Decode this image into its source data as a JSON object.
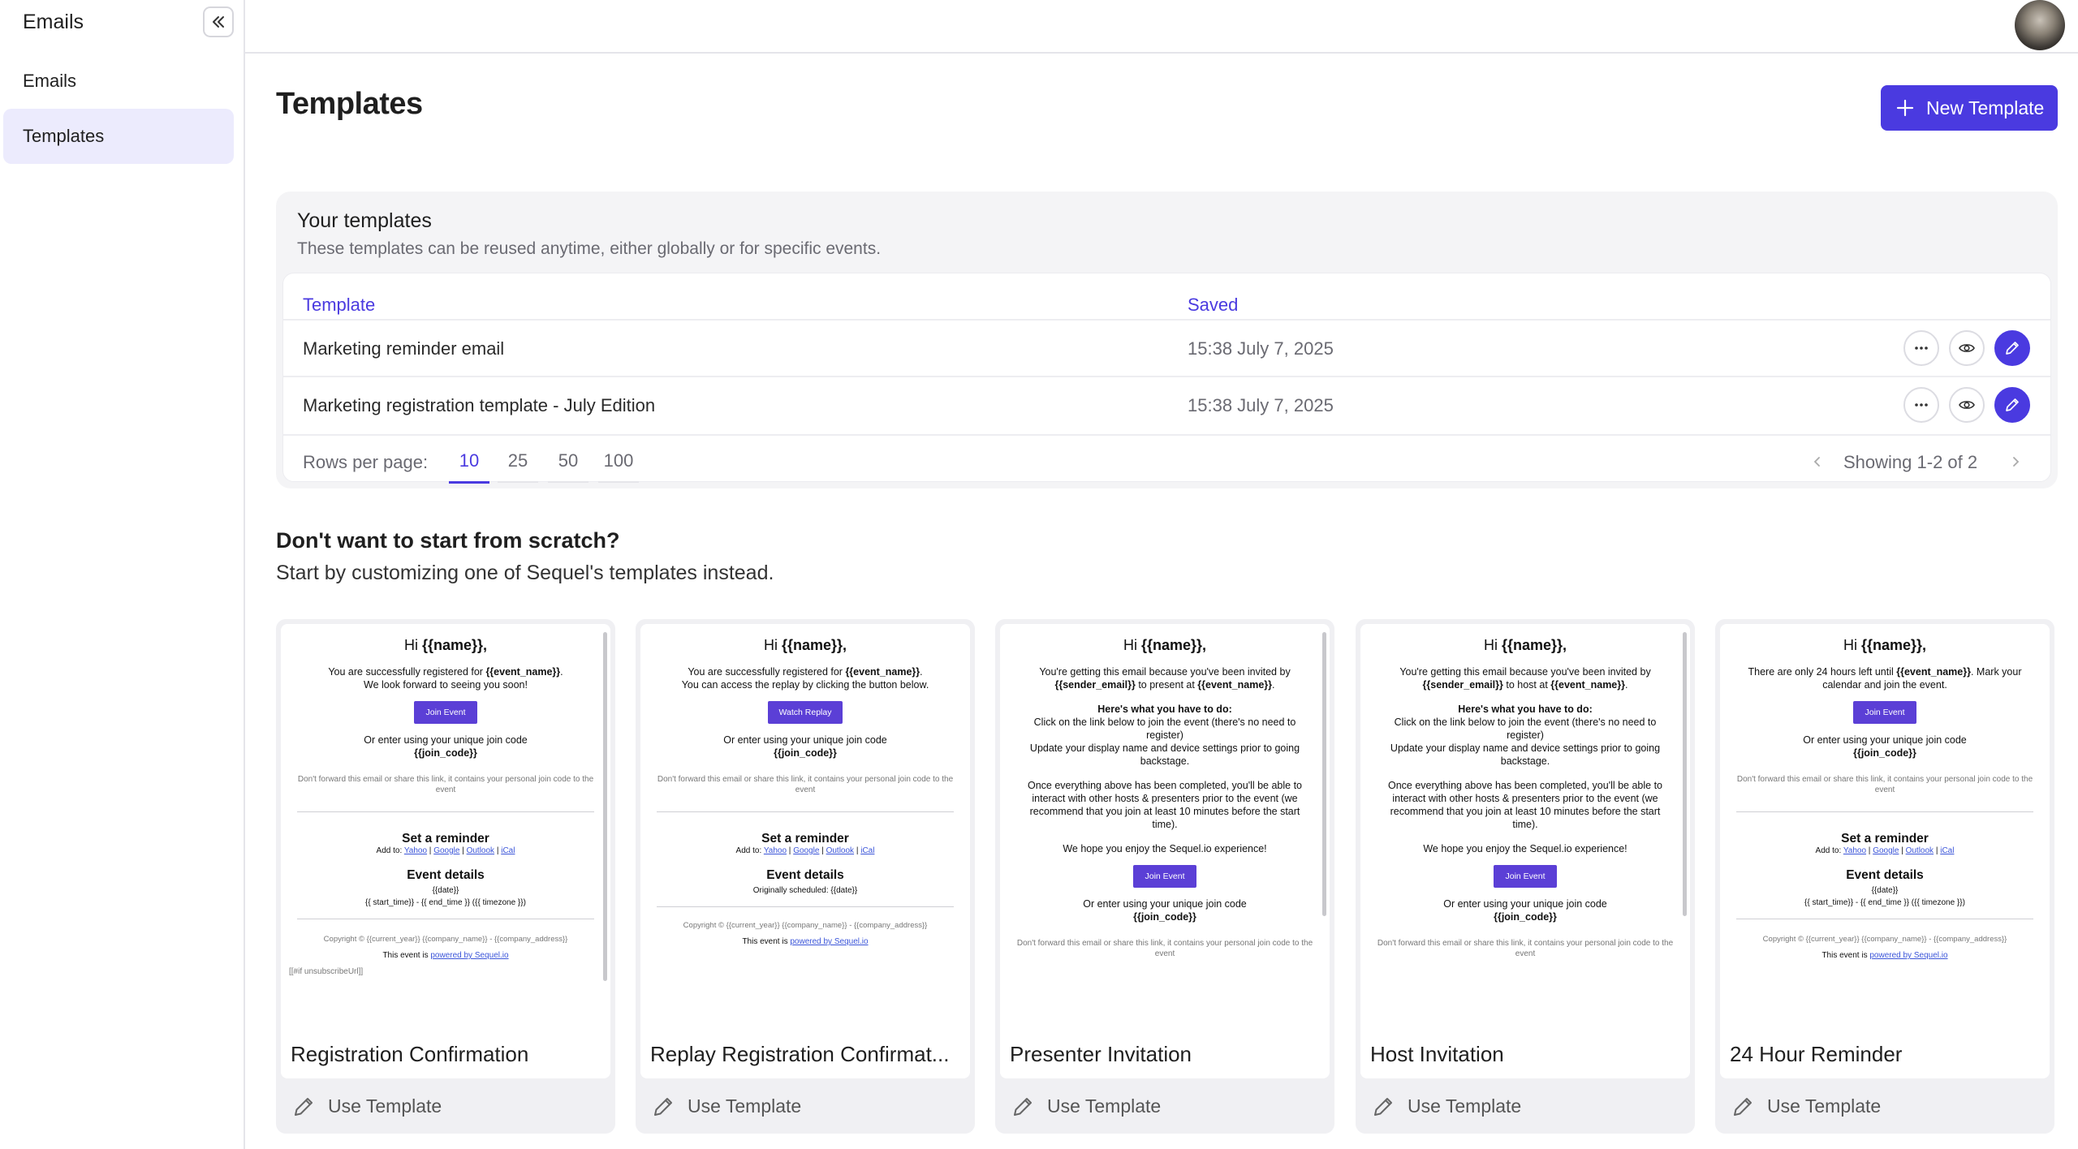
{
  "sidebar": {
    "title": "Emails",
    "items": [
      {
        "label": "Emails",
        "active": false
      },
      {
        "label": "Templates",
        "active": true
      }
    ]
  },
  "page": {
    "title": "Templates",
    "new_button_label": "New Template"
  },
  "your_templates": {
    "title": "Your templates",
    "subtitle": "These templates can be reused anytime, either globally or for specific events.",
    "columns": [
      "Template",
      "Saved"
    ],
    "rows": [
      {
        "name": "Marketing reminder email",
        "saved": "15:38 July 7, 2025"
      },
      {
        "name": "Marketing registration template - July Edition",
        "saved": "15:38 July 7, 2025"
      }
    ],
    "rows_per_page_label": "Rows per page:",
    "rows_per_page_options": [
      "10",
      "25",
      "50",
      "100"
    ],
    "rows_per_page_selected": "10",
    "showing": "Showing 1-2 of 2"
  },
  "scratch": {
    "title": "Don't want to start from scratch?",
    "subtitle": "Start by customizing one of Sequel's templates instead."
  },
  "cards": [
    {
      "name": "Registration Confirmation",
      "action": "Use Template",
      "preview": {
        "greet_prefix": "Hi ",
        "greet_var": "{{name}},",
        "l1a": "You are successfully registered for ",
        "l1b": "{{event_name}}",
        "l1c": ".",
        "l2": "We look forward to seeing you soon!",
        "button": "Join Event",
        "code_line": "Or enter using your unique join code",
        "code": "{{join_code}}",
        "note": "Don't forward this email or share this link, it contains your personal join code to the event",
        "reminder_title": "Set a reminder",
        "add_to": "Add to:",
        "cal": [
          "Yahoo",
          "Google",
          "Outlook",
          "iCal"
        ],
        "details_title": "Event details",
        "date": "{{date}}",
        "time": "{{ start_time}} - {{ end_time }} ({{ timezone }})",
        "copyright": "Copyright © {{current_year}} {{company_name}} - {{company_address}}",
        "powered_prefix": "This event is ",
        "powered": "powered by Sequel.io",
        "unsub": "[[#if unsubscribeUrl]]"
      }
    },
    {
      "name": "Replay Registration Confirmat...",
      "action": "Use Template",
      "preview": {
        "greet_prefix": "Hi ",
        "greet_var": "{{name}},",
        "l1a": "You are successfully registered for ",
        "l1b": "{{event_name}}",
        "l1c": ".",
        "l2": "You can access the replay by clicking the button below.",
        "button": "Watch Replay",
        "code_line": "Or enter using your unique join code",
        "code": "{{join_code}}",
        "note": "Don't forward this email or share this link, it contains your personal join code to the event",
        "reminder_title": "Set a reminder",
        "add_to": "Add to:",
        "cal": [
          "Yahoo",
          "Google",
          "Outlook",
          "iCal"
        ],
        "details_title": "Event details",
        "orig": "Originally scheduled: {{date}}",
        "copyright": "Copyright © {{current_year}} {{company_name}} - {{company_address}}",
        "powered_prefix": "This event is ",
        "powered": "powered by Sequel.io"
      }
    },
    {
      "name": "Presenter Invitation",
      "action": "Use Template",
      "preview": {
        "greet_prefix": "Hi ",
        "greet_var": "{{name}},",
        "l1a": "You're getting this email because you've been invited by ",
        "l1b": "{{sender_email}}",
        "l1c": " to present at ",
        "l1d": "{{event_name}}",
        "l1e": ".",
        "todo_title": "Here's what you have to do:",
        "todo1": "Click on the link below to join the event (there's no need to register)",
        "todo2": "Update your display name and device settings prior to going backstage.",
        "after": "Once everything above has been completed, you'll be able to interact with other hosts & presenters prior to the event (we recommend that you join at least 10 minutes before the start time).",
        "enjoy": "We hope you enjoy the Sequel.io experience!",
        "button": "Join Event",
        "code_line": "Or enter using your unique join code",
        "code": "{{join_code}}",
        "note": "Don't forward this email or share this link, it contains your personal join code to the event"
      }
    },
    {
      "name": "Host Invitation",
      "action": "Use Template",
      "preview": {
        "greet_prefix": "Hi ",
        "greet_var": "{{name}},",
        "l1a": "You're getting this email because you've been invited by ",
        "l1b": "{{sender_email}}",
        "l1c": " to host at ",
        "l1d": "{{event_name}}",
        "l1e": ".",
        "todo_title": "Here's what you have to do:",
        "todo1": "Click on the link below to join the event (there's no need to register)",
        "todo2": "Update your display name and device settings prior to going backstage.",
        "after": "Once everything above has been completed, you'll be able to interact with other hosts & presenters prior to the event (we recommend that you join at least 10 minutes before the start time).",
        "enjoy": "We hope you enjoy the Sequel.io experience!",
        "button": "Join Event",
        "code_line": "Or enter using your unique join code",
        "code": "{{join_code}}",
        "note": "Don't forward this email or share this link, it contains your personal join code to the event"
      }
    },
    {
      "name": "24 Hour Reminder",
      "action": "Use Template",
      "preview": {
        "greet_prefix": "Hi ",
        "greet_var": "{{name}},",
        "l1a": "There are only 24 hours left until ",
        "l1b": "{{event_name}}",
        "l1c": ". Mark your calendar and join the event.",
        "button": "Join Event",
        "code_line": "Or enter using your unique join code",
        "code": "{{join_code}}",
        "note": "Don't forward this email or share this link, it contains your personal join code to the event",
        "reminder_title": "Set a reminder",
        "add_to": "Add to:",
        "cal": [
          "Yahoo",
          "Google",
          "Outlook",
          "iCal"
        ],
        "details_title": "Event details",
        "date": "{{date}}",
        "time": "{{ start_time}} - {{ end_time }} ({{ timezone }})",
        "copyright": "Copyright © {{current_year}} {{company_name}} - {{company_address}}",
        "powered_prefix": "This event is ",
        "powered": "powered by Sequel.io"
      }
    }
  ],
  "colors": {
    "accent": "#4a3ae0",
    "sidebar_active": "#ecebfd",
    "email_button": "#5b3fd6"
  },
  "icons": [
    "collapse-double-chevron-left-icon",
    "plus-icon",
    "more-horizontal-icon",
    "eye-icon",
    "pencil-icon",
    "chevron-left-icon",
    "chevron-right-icon"
  ]
}
